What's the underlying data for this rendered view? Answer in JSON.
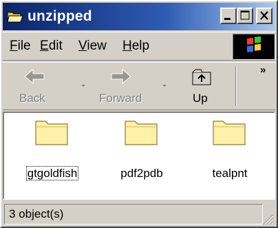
{
  "window": {
    "title": "unzipped",
    "title_icon": "folder-open-icon",
    "controls": [
      "minimize-icon",
      "maximize-icon",
      "close-icon"
    ]
  },
  "menu": {
    "items": [
      {
        "label": "File",
        "mnemonic": "F",
        "rest": "ile"
      },
      {
        "label": "Edit",
        "mnemonic": "E",
        "rest": "dit"
      },
      {
        "label": "View",
        "mnemonic": "V",
        "rest": "iew"
      },
      {
        "label": "Help",
        "mnemonic": "H",
        "rest": "elp"
      }
    ],
    "logo_icon": "windows-logo-icon"
  },
  "toolbar": {
    "back_label": "Back",
    "forward_label": "Forward",
    "up_label": "Up",
    "overflow": "»"
  },
  "files": [
    {
      "name": "gtgoldfish",
      "icon": "folder-icon",
      "focused": true
    },
    {
      "name": "pdf2pdb",
      "icon": "folder-icon",
      "focused": false
    },
    {
      "name": "tealpnt",
      "icon": "folder-icon",
      "focused": false
    }
  ],
  "status": {
    "text": "3 object(s)"
  },
  "colors": {
    "titlebar_start": "#0a246a",
    "titlebar_end": "#a6caf0",
    "face": "#d4d0c8",
    "folder": "#fff1a8"
  }
}
